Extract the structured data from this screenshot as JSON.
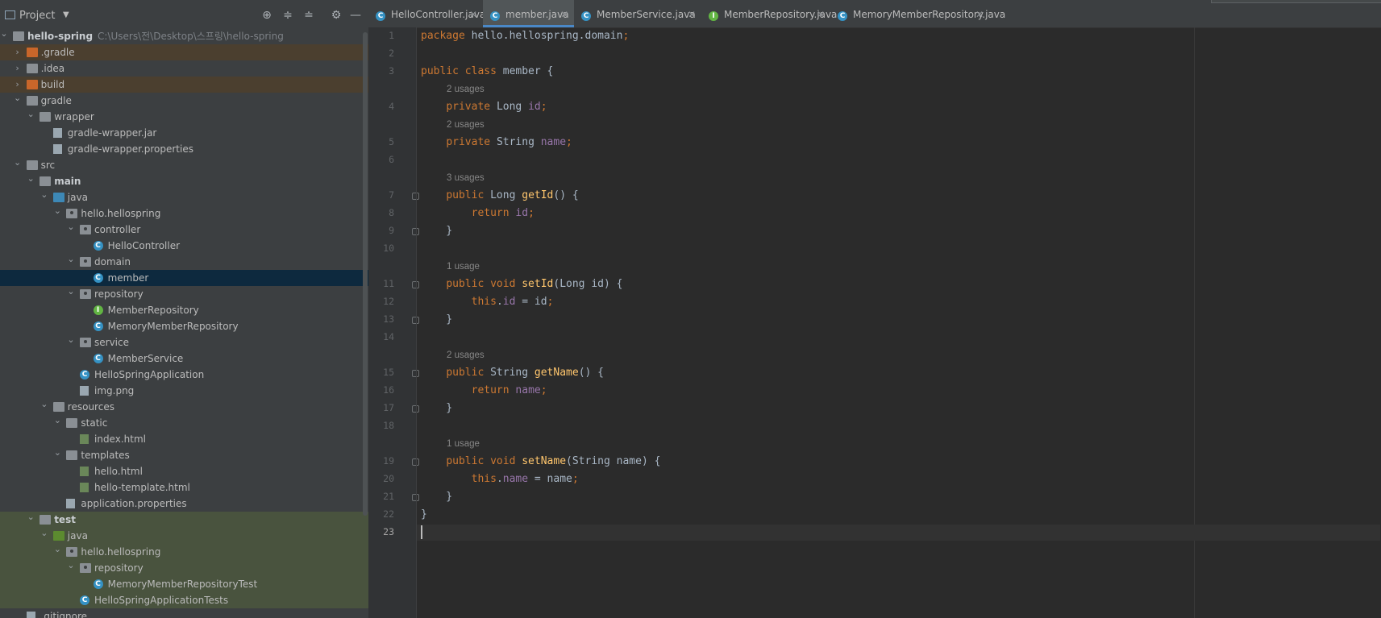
{
  "project_panel": {
    "title": "Project",
    "tree": [
      {
        "id": "root",
        "label": "hello-spring",
        "path": "C:\\Users\\전\\Desktop\\스프링\\hello-spring",
        "depth": 0,
        "expanded": true,
        "icon": "module-folder-icon",
        "bold": true
      },
      {
        "id": "gradle-hidden",
        "label": ".gradle",
        "depth": 1,
        "expanded": false,
        "icon": "excluded-folder-icon",
        "highlight": "orange"
      },
      {
        "id": "idea",
        "label": ".idea",
        "depth": 1,
        "expanded": false,
        "icon": "folder-icon"
      },
      {
        "id": "build",
        "label": "build",
        "depth": 1,
        "expanded": false,
        "icon": "excluded-folder-icon",
        "highlight": "orange"
      },
      {
        "id": "gradle",
        "label": "gradle",
        "depth": 1,
        "expanded": true,
        "icon": "folder-icon"
      },
      {
        "id": "wrapper",
        "label": "wrapper",
        "depth": 2,
        "expanded": true,
        "icon": "folder-icon"
      },
      {
        "id": "gradle-wrapper-jar",
        "label": "gradle-wrapper.jar",
        "depth": 3,
        "icon": "jar-icon"
      },
      {
        "id": "gradle-wrapper-props",
        "label": "gradle-wrapper.properties",
        "depth": 3,
        "icon": "properties-icon"
      },
      {
        "id": "src",
        "label": "src",
        "depth": 1,
        "expanded": true,
        "icon": "folder-icon"
      },
      {
        "id": "main",
        "label": "main",
        "depth": 2,
        "expanded": true,
        "icon": "module-folder-icon",
        "bold": true
      },
      {
        "id": "java-main",
        "label": "java",
        "depth": 3,
        "expanded": true,
        "icon": "source-folder-icon"
      },
      {
        "id": "pkg-main",
        "label": "hello.hellospring",
        "depth": 4,
        "expanded": true,
        "icon": "package-icon"
      },
      {
        "id": "controller",
        "label": "controller",
        "depth": 5,
        "expanded": true,
        "icon": "package-icon"
      },
      {
        "id": "HelloController",
        "label": "HelloController",
        "depth": 6,
        "icon": "class-icon"
      },
      {
        "id": "domain",
        "label": "domain",
        "depth": 5,
        "expanded": true,
        "icon": "package-icon"
      },
      {
        "id": "member",
        "label": "member",
        "depth": 6,
        "icon": "class-icon",
        "selected": true
      },
      {
        "id": "repository",
        "label": "repository",
        "depth": 5,
        "expanded": true,
        "icon": "package-icon"
      },
      {
        "id": "MemberRepository",
        "label": "MemberRepository",
        "depth": 6,
        "icon": "interface-icon"
      },
      {
        "id": "MemoryMemberRepository",
        "label": "MemoryMemberRepository",
        "depth": 6,
        "icon": "class-icon"
      },
      {
        "id": "service",
        "label": "service",
        "depth": 5,
        "expanded": true,
        "icon": "package-icon"
      },
      {
        "id": "MemberService",
        "label": "MemberService",
        "depth": 6,
        "icon": "class-icon"
      },
      {
        "id": "HelloSpringApplication",
        "label": "HelloSpringApplication",
        "depth": 5,
        "icon": "spring-class-icon"
      },
      {
        "id": "img",
        "label": "img.png",
        "depth": 5,
        "icon": "image-file-icon"
      },
      {
        "id": "resources",
        "label": "resources",
        "depth": 3,
        "expanded": true,
        "icon": "resources-folder-icon"
      },
      {
        "id": "static",
        "label": "static",
        "depth": 4,
        "expanded": true,
        "icon": "folder-icon"
      },
      {
        "id": "index",
        "label": "index.html",
        "depth": 5,
        "icon": "html-file-icon"
      },
      {
        "id": "templates",
        "label": "templates",
        "depth": 4,
        "expanded": true,
        "icon": "folder-icon"
      },
      {
        "id": "hello",
        "label": "hello.html",
        "depth": 5,
        "icon": "html-file-icon"
      },
      {
        "id": "hello-template",
        "label": "hello-template.html",
        "depth": 5,
        "icon": "html-file-icon"
      },
      {
        "id": "app-props",
        "label": "application.properties",
        "depth": 4,
        "icon": "properties-icon"
      },
      {
        "id": "test",
        "label": "test",
        "depth": 2,
        "expanded": true,
        "icon": "module-folder-icon",
        "bold": true,
        "highlight": "green"
      },
      {
        "id": "java-test",
        "label": "java",
        "depth": 3,
        "expanded": true,
        "icon": "test-folder-icon",
        "highlight": "green"
      },
      {
        "id": "pkg-test",
        "label": "hello.hellospring",
        "depth": 4,
        "expanded": true,
        "icon": "package-icon",
        "highlight": "green"
      },
      {
        "id": "repo-test",
        "label": "repository",
        "depth": 5,
        "expanded": true,
        "icon": "package-icon",
        "highlight": "green"
      },
      {
        "id": "MemoryMemberRepositoryTest",
        "label": "MemoryMemberRepositoryTest",
        "depth": 6,
        "icon": "spring-class-icon",
        "highlight": "green"
      },
      {
        "id": "HelloSpringApplicationTests",
        "label": "HelloSpringApplicationTests",
        "depth": 5,
        "icon": "spring-class-icon",
        "highlight": "green"
      },
      {
        "id": "gitignore",
        "label": ".gitignore",
        "depth": 1,
        "icon": "file-icon"
      }
    ]
  },
  "tabs": [
    {
      "label": "HelloController.java",
      "kind": "C",
      "active": false
    },
    {
      "label": "member.java",
      "kind": "C",
      "active": true
    },
    {
      "label": "MemberService.java",
      "kind": "C",
      "active": false
    },
    {
      "label": "MemberRepository.java",
      "kind": "I",
      "active": false
    },
    {
      "label": "MemoryMemberRepository.java",
      "kind": "C",
      "active": false
    }
  ],
  "editor": {
    "current_line": 23,
    "lines": [
      {
        "n": 1,
        "tokens": [
          [
            "kw",
            "package "
          ],
          [
            "pl",
            "hello.hellospring.domain"
          ],
          [
            "kw",
            ";"
          ]
        ]
      },
      {
        "n": 2,
        "tokens": []
      },
      {
        "n": 3,
        "tokens": [
          [
            "kw",
            "public class "
          ],
          [
            "pl",
            "member {"
          ]
        ]
      },
      {
        "hint": "2 usages"
      },
      {
        "n": 4,
        "tokens": [
          [
            "pl",
            "    "
          ],
          [
            "kw",
            "private "
          ],
          [
            "pl",
            "Long "
          ],
          [
            "fd",
            "id"
          ],
          [
            "kw",
            ";"
          ]
        ]
      },
      {
        "hint": "2 usages"
      },
      {
        "n": 5,
        "tokens": [
          [
            "pl",
            "    "
          ],
          [
            "kw",
            "private "
          ],
          [
            "pl",
            "String "
          ],
          [
            "fd",
            "name"
          ],
          [
            "kw",
            ";"
          ]
        ]
      },
      {
        "n": 6,
        "tokens": []
      },
      {
        "hint": "3 usages"
      },
      {
        "n": 7,
        "fold": true,
        "tokens": [
          [
            "pl",
            "    "
          ],
          [
            "kw",
            "public "
          ],
          [
            "pl",
            "Long "
          ],
          [
            "mt",
            "getId"
          ],
          [
            "pl",
            "() {"
          ]
        ]
      },
      {
        "n": 8,
        "tokens": [
          [
            "pl",
            "        "
          ],
          [
            "kw",
            "return "
          ],
          [
            "fd",
            "id"
          ],
          [
            "kw",
            ";"
          ]
        ]
      },
      {
        "n": 9,
        "fold": true,
        "tokens": [
          [
            "pl",
            "    }"
          ]
        ]
      },
      {
        "n": 10,
        "tokens": []
      },
      {
        "hint": "1 usage"
      },
      {
        "n": 11,
        "fold": true,
        "tokens": [
          [
            "pl",
            "    "
          ],
          [
            "kw",
            "public void "
          ],
          [
            "mt",
            "setId"
          ],
          [
            "pl",
            "(Long id) {"
          ]
        ]
      },
      {
        "n": 12,
        "tokens": [
          [
            "pl",
            "        "
          ],
          [
            "kw",
            "this"
          ],
          [
            "pl",
            "."
          ],
          [
            "fd",
            "id"
          ],
          [
            "pl",
            " = id"
          ],
          [
            "kw",
            ";"
          ]
        ]
      },
      {
        "n": 13,
        "fold": true,
        "tokens": [
          [
            "pl",
            "    }"
          ]
        ]
      },
      {
        "n": 14,
        "tokens": []
      },
      {
        "hint": "2 usages"
      },
      {
        "n": 15,
        "fold": true,
        "tokens": [
          [
            "pl",
            "    "
          ],
          [
            "kw",
            "public "
          ],
          [
            "pl",
            "String "
          ],
          [
            "mt",
            "getName"
          ],
          [
            "pl",
            "() {"
          ]
        ]
      },
      {
        "n": 16,
        "tokens": [
          [
            "pl",
            "        "
          ],
          [
            "kw",
            "return "
          ],
          [
            "fd",
            "name"
          ],
          [
            "kw",
            ";"
          ]
        ]
      },
      {
        "n": 17,
        "fold": true,
        "tokens": [
          [
            "pl",
            "    }"
          ]
        ]
      },
      {
        "n": 18,
        "tokens": []
      },
      {
        "hint": "1 usage"
      },
      {
        "n": 19,
        "fold": true,
        "tokens": [
          [
            "pl",
            "    "
          ],
          [
            "kw",
            "public void "
          ],
          [
            "mt",
            "setName"
          ],
          [
            "pl",
            "(String name) {"
          ]
        ]
      },
      {
        "n": 20,
        "tokens": [
          [
            "pl",
            "        "
          ],
          [
            "kw",
            "this"
          ],
          [
            "pl",
            "."
          ],
          [
            "fd",
            "name"
          ],
          [
            "pl",
            " = name"
          ],
          [
            "kw",
            ";"
          ]
        ]
      },
      {
        "n": 21,
        "fold": true,
        "tokens": [
          [
            "pl",
            "    }"
          ]
        ]
      },
      {
        "n": 22,
        "tokens": [
          [
            "pl",
            "}"
          ]
        ]
      },
      {
        "n": 23,
        "tokens": []
      }
    ]
  },
  "colors": {
    "keyword": "#cc7832",
    "field": "#9876aa",
    "method": "#ffc66d",
    "plain": "#a9b7c6",
    "selection": "#0d293e",
    "excluded_highlight": "#4b3f2f",
    "test_highlight": "#49533e"
  }
}
